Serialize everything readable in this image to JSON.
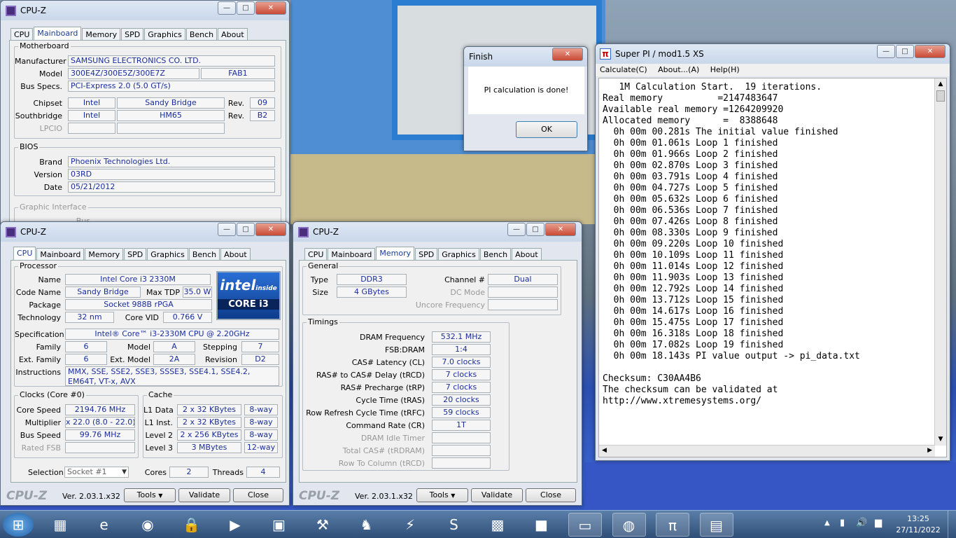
{
  "cpuz_main": {
    "title": "CPU-Z",
    "tabs": [
      "CPU",
      "Mainboard",
      "Memory",
      "SPD",
      "Graphics",
      "Bench",
      "About"
    ],
    "motherboard": {
      "group": "Motherboard",
      "manufacturer_label": "Manufacturer",
      "manufacturer": "SAMSUNG ELECTRONICS CO. LTD.",
      "model_label": "Model",
      "model": "300E4Z/300E5Z/300E7Z",
      "model_rev": "FAB1",
      "busspecs_label": "Bus Specs.",
      "busspecs": "PCI-Express 2.0 (5.0 GT/s)",
      "chipset_label": "Chipset",
      "chipset_vendor": "Intel",
      "chipset_name": "Sandy Bridge",
      "chipset_rev_label": "Rev.",
      "chipset_rev": "09",
      "southbridge_label": "Southbridge",
      "sb_vendor": "Intel",
      "sb_name": "HM65",
      "sb_rev_label": "Rev.",
      "sb_rev": "B2",
      "lpcio_label": "LPCIO"
    },
    "bios": {
      "group": "BIOS",
      "brand_label": "Brand",
      "brand": "Phoenix Technologies Ltd.",
      "version_label": "Version",
      "version": "03RD",
      "date_label": "Date",
      "date": "05/21/2012"
    },
    "graphic_interface": "Graphic Interface",
    "bus_label": "Bus"
  },
  "cpuz_cpu": {
    "title": "CPU-Z",
    "tabs": [
      "CPU",
      "Mainboard",
      "Memory",
      "SPD",
      "Graphics",
      "Bench",
      "About"
    ],
    "processor": {
      "group": "Processor",
      "name_label": "Name",
      "name": "Intel Core i3 2330M",
      "codename_label": "Code Name",
      "codename": "Sandy Bridge",
      "maxtdp_label": "Max TDP",
      "maxtdp": "35.0 W",
      "package_label": "Package",
      "package": "Socket 988B rPGA",
      "tech_label": "Technology",
      "tech": "32 nm",
      "corevid_label": "Core VID",
      "corevid": "0.766 V",
      "spec_label": "Specification",
      "spec": "Intel® Core™ i3-2330M CPU @ 2.20GHz",
      "family_label": "Family",
      "family": "6",
      "model_label": "Model",
      "model": "A",
      "stepping_label": "Stepping",
      "stepping": "7",
      "extfamily_label": "Ext. Family",
      "extfamily": "6",
      "extmodel_label": "Ext. Model",
      "extmodel": "2A",
      "revision_label": "Revision",
      "revision": "D2",
      "instr_label": "Instructions",
      "instr": "MMX, SSE, SSE2, SSE3, SSSE3, SSE4.1, SSE4.2, EM64T, VT-x, AVX"
    },
    "logo": {
      "brand": "intel",
      "tag": "inside",
      "line": "CORE i3"
    },
    "clocks": {
      "group": "Clocks (Core #0)",
      "corespeed_label": "Core Speed",
      "corespeed": "2194.76 MHz",
      "mult_label": "Multiplier",
      "mult": "x 22.0 (8.0 - 22.0)",
      "busspeed_label": "Bus Speed",
      "busspeed": "99.76 MHz",
      "ratedfsb_label": "Rated FSB"
    },
    "cache": {
      "group": "Cache",
      "l1d_label": "L1 Data",
      "l1d": "2 x 32 KBytes",
      "l1d_w": "8-way",
      "l1i_label": "L1 Inst.",
      "l1i": "2 x 32 KBytes",
      "l1i_w": "8-way",
      "l2_label": "Level 2",
      "l2": "2 x 256 KBytes",
      "l2_w": "8-way",
      "l3_label": "Level 3",
      "l3": "3 MBytes",
      "l3_w": "12-way"
    },
    "selection_label": "Selection",
    "selection": "Socket #1",
    "cores_label": "Cores",
    "cores": "2",
    "threads_label": "Threads",
    "threads": "4",
    "footer": {
      "logo": "CPU-Z",
      "version": "Ver. 2.03.1.x32",
      "tools": "Tools",
      "validate": "Validate",
      "close": "Close"
    }
  },
  "cpuz_mem": {
    "title": "CPU-Z",
    "tabs": [
      "CPU",
      "Mainboard",
      "Memory",
      "SPD",
      "Graphics",
      "Bench",
      "About"
    ],
    "general": {
      "group": "General",
      "type_label": "Type",
      "type": "DDR3",
      "channel_label": "Channel #",
      "channel": "Dual",
      "size_label": "Size",
      "size": "4 GBytes",
      "dcmode_label": "DC Mode",
      "uncore_label": "Uncore Frequency"
    },
    "timings": {
      "group": "Timings",
      "rows": [
        {
          "label": "DRAM Frequency",
          "value": "532.1 MHz",
          "dim": false
        },
        {
          "label": "FSB:DRAM",
          "value": "1:4",
          "dim": false
        },
        {
          "label": "CAS# Latency (CL)",
          "value": "7.0 clocks",
          "dim": false
        },
        {
          "label": "RAS# to CAS# Delay (tRCD)",
          "value": "7 clocks",
          "dim": false
        },
        {
          "label": "RAS# Precharge (tRP)",
          "value": "7 clocks",
          "dim": false
        },
        {
          "label": "Cycle Time (tRAS)",
          "value": "20 clocks",
          "dim": false
        },
        {
          "label": "Row Refresh Cycle Time (tRFC)",
          "value": "59 clocks",
          "dim": false
        },
        {
          "label": "Command Rate (CR)",
          "value": "1T",
          "dim": false
        },
        {
          "label": "DRAM Idle Timer",
          "value": "",
          "dim": true
        },
        {
          "label": "Total CAS# (tRDRAM)",
          "value": "",
          "dim": true
        },
        {
          "label": "Row To Column (tRCD)",
          "value": "",
          "dim": true
        }
      ]
    },
    "footer": {
      "logo": "CPU-Z",
      "version": "Ver. 2.03.1.x32",
      "tools": "Tools",
      "validate": "Validate",
      "close": "Close"
    }
  },
  "finish": {
    "title": "Finish",
    "message": "PI calculation is done!",
    "ok": "OK"
  },
  "superpi": {
    "title": "Super PI / mod1.5 XS",
    "menu": [
      "Calculate(C)",
      "About...(A)",
      "Help(H)"
    ],
    "lines": [
      "   1M Calculation Start.  19 iterations.",
      "Real memory          =2147483647",
      "Available real memory =1264209920",
      "Allocated memory      =  8388648",
      "  0h 00m 00.281s The initial value finished",
      "  0h 00m 01.061s Loop 1 finished",
      "  0h 00m 01.966s Loop 2 finished",
      "  0h 00m 02.870s Loop 3 finished",
      "  0h 00m 03.791s Loop 4 finished",
      "  0h 00m 04.727s Loop 5 finished",
      "  0h 00m 05.632s Loop 6 finished",
      "  0h 00m 06.536s Loop 7 finished",
      "  0h 00m 07.426s Loop 8 finished",
      "  0h 00m 08.330s Loop 9 finished",
      "  0h 00m 09.220s Loop 10 finished",
      "  0h 00m 10.109s Loop 11 finished",
      "  0h 00m 11.014s Loop 12 finished",
      "  0h 00m 11.903s Loop 13 finished",
      "  0h 00m 12.792s Loop 14 finished",
      "  0h 00m 13.712s Loop 15 finished",
      "  0h 00m 14.617s Loop 16 finished",
      "  0h 00m 15.475s Loop 17 finished",
      "  0h 00m 16.318s Loop 18 finished",
      "  0h 00m 17.082s Loop 19 finished",
      "  0h 00m 18.143s PI value output -> pi_data.txt",
      "",
      "Checksum: C30AA4B6",
      "The checksum can be validated at",
      "http://www.xtremesystems.org/"
    ]
  },
  "taskbar": {
    "time": "13:25",
    "date": "27/11/2022",
    "items": [
      {
        "name": "start-orb-icon",
        "glyph": "⊞"
      },
      {
        "name": "control-panel-icon",
        "glyph": "▦"
      },
      {
        "name": "internet-explorer-icon",
        "glyph": "e"
      },
      {
        "name": "chrome-icon",
        "glyph": "◉"
      },
      {
        "name": "keepass-icon",
        "glyph": "🔒"
      },
      {
        "name": "media-player-icon",
        "glyph": "▶"
      },
      {
        "name": "terminal-icon",
        "glyph": "▣"
      },
      {
        "name": "shovel-icon",
        "glyph": "⚒"
      },
      {
        "name": "figure-icon",
        "glyph": "♞"
      },
      {
        "name": "lightning-icon",
        "glyph": "⚡"
      },
      {
        "name": "sublime-icon",
        "glyph": "S"
      },
      {
        "name": "minecraft-chest-icon",
        "glyph": "▩"
      },
      {
        "name": "minecraft-grass-icon",
        "glyph": "■"
      },
      {
        "name": "folder-icon",
        "glyph": "▭"
      },
      {
        "name": "firefox-icon",
        "glyph": "◍"
      },
      {
        "name": "superpi-icon",
        "glyph": "π"
      },
      {
        "name": "cpuz-icon",
        "glyph": "▤"
      }
    ]
  }
}
